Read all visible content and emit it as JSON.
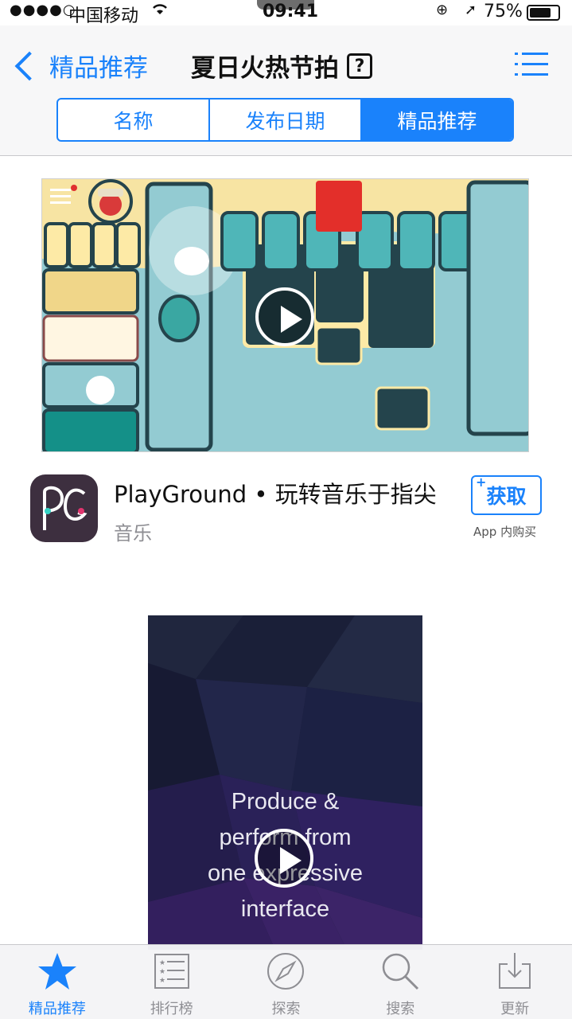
{
  "status_bar": {
    "signal": "●●●●○",
    "carrier": "中国移动",
    "wifi": "wifi-icon",
    "time": "09:41",
    "battery_percent": "75%",
    "battery_level": 0.75
  },
  "nav": {
    "back_label": "精品推荐",
    "title": "夏日火热节拍",
    "help_icon": "?",
    "menu_icon": "list-icon"
  },
  "segments": [
    {
      "label": "名称",
      "active": false
    },
    {
      "label": "发布日期",
      "active": false
    },
    {
      "label": "精品推荐",
      "active": true
    }
  ],
  "app": {
    "name": "PlayGround • 玩转音乐于指尖",
    "category": "音乐",
    "get_label": "获取",
    "get_plus": "+",
    "iap_note": "App 内购买"
  },
  "preview2": {
    "caption_lines": [
      "Produce &",
      "perform from",
      "one expressive",
      "interface"
    ]
  },
  "tabbar": [
    {
      "label": "精品推荐",
      "icon": "star-icon",
      "active": true
    },
    {
      "label": "排行榜",
      "icon": "ranking-list-icon",
      "active": false
    },
    {
      "label": "探索",
      "icon": "compass-icon",
      "active": false
    },
    {
      "label": "搜索",
      "icon": "search-icon",
      "active": false
    },
    {
      "label": "更新",
      "icon": "download-tray-icon",
      "active": false
    }
  ],
  "colors": {
    "accent": "#1a82fb",
    "tab_inactive": "#8e8e93"
  }
}
